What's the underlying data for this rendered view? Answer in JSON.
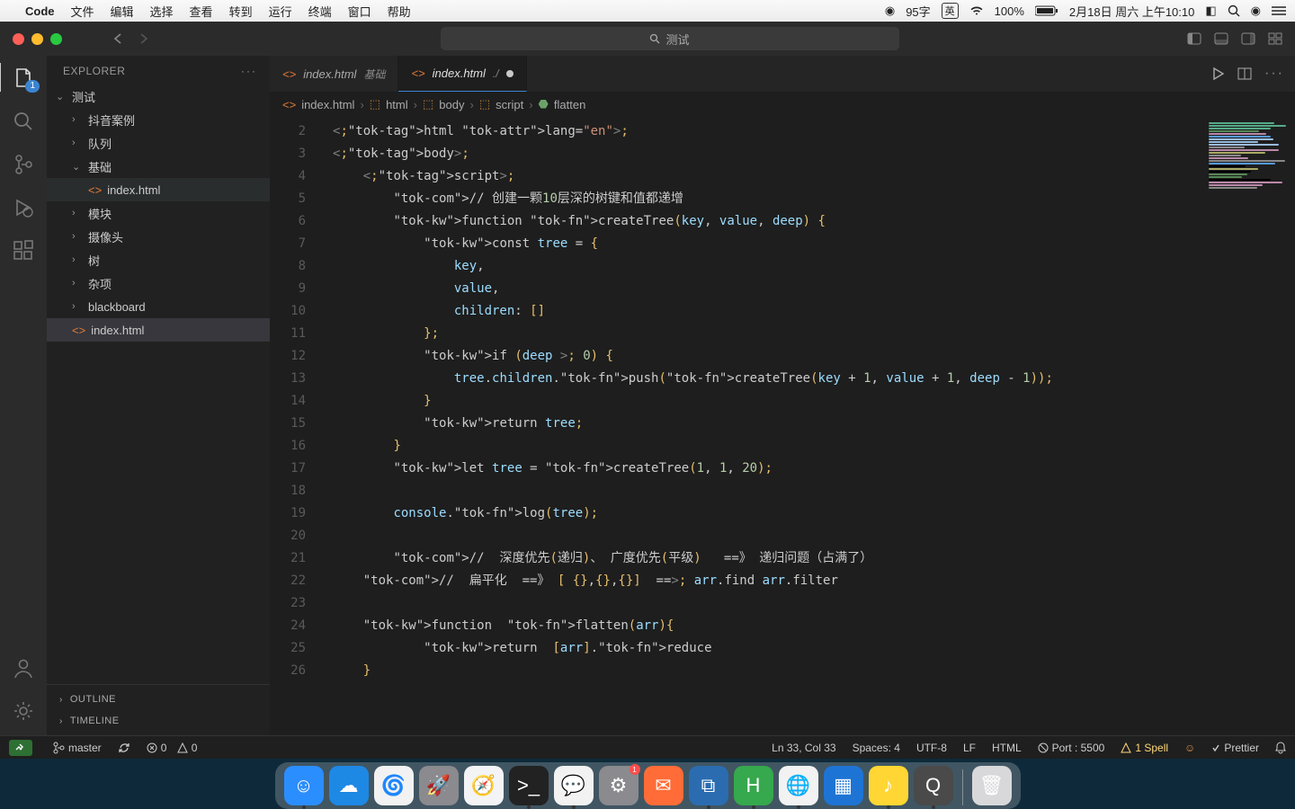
{
  "menubar": {
    "app": "Code",
    "items": [
      "文件",
      "编辑",
      "选择",
      "查看",
      "转到",
      "运行",
      "终端",
      "窗口",
      "帮助"
    ],
    "right": {
      "input": "95字",
      "lang": "英",
      "battery": "100%",
      "date": "2月18日 周六 上午10:10"
    }
  },
  "titlebar": {
    "search": "测试"
  },
  "activity_badge": "1",
  "explorer": {
    "title": "EXPLORER",
    "root": "测试",
    "items": [
      {
        "label": "抖音案例",
        "type": "folder"
      },
      {
        "label": "队列",
        "type": "folder"
      },
      {
        "label": "基础",
        "type": "folder",
        "open": true,
        "children": [
          {
            "label": "index.html",
            "type": "html",
            "sel": true
          }
        ]
      },
      {
        "label": "模块",
        "type": "folder"
      },
      {
        "label": "摄像头",
        "type": "folder"
      },
      {
        "label": "树",
        "type": "folder"
      },
      {
        "label": "杂项",
        "type": "folder"
      },
      {
        "label": "blackboard",
        "type": "folder"
      },
      {
        "label": "index.html",
        "type": "html",
        "active": true
      }
    ],
    "footer": [
      "OUTLINE",
      "TIMELINE"
    ]
  },
  "tabs": [
    {
      "file": "index.html",
      "desc": "基础",
      "active": false
    },
    {
      "file": "index.html",
      "desc": "./",
      "active": true,
      "modified": true
    }
  ],
  "breadcrumbs": [
    "index.html",
    "html",
    "body",
    "script",
    "flatten"
  ],
  "code": {
    "start": 2,
    "lines": [
      "<html lang=\"en\">",
      "<body>",
      "    <script>",
      "        // 创建一颗10层深的树键和值都递增",
      "        function createTree(key, value, deep) {",
      "            const tree = {",
      "                key,",
      "                value,",
      "                children: []",
      "            };",
      "            if (deep > 0) {",
      "                tree.children.push(createTree(key + 1, value + 1, deep - 1));",
      "            }",
      "            return tree;",
      "        }",
      "        let tree = createTree(1, 1, 20);",
      "",
      "        console.log(tree);",
      "",
      "        //  深度优先(递归)、 广度优先(平级)   ==》 递归问题（占满了）",
      "    //  扁平化  ==》 [ {},{},{}]  ==> arr.find arr.filter",
      "",
      "    function  flatten(arr){",
      "            return  [arr].reduce",
      "    }"
    ],
    "cursor_line": 33,
    "bulb_line": 33
  },
  "status": {
    "branch": "master",
    "sync": "",
    "errors": "0",
    "warnings": "0",
    "pos": "Ln 33, Col 33",
    "spaces": "Spaces: 4",
    "enc": "UTF-8",
    "eol": "LF",
    "lang": "HTML",
    "port": "Port : 5500",
    "spell": "1 Spell",
    "formatter": "Prettier"
  },
  "dock": [
    {
      "name": "finder",
      "bg": "#2b8eff",
      "emoji": "☺",
      "running": true
    },
    {
      "name": "baidu",
      "bg": "#1e88e5",
      "emoji": "☁"
    },
    {
      "name": "nie",
      "bg": "#f2f2f2",
      "emoji": "🌀"
    },
    {
      "name": "launchpad",
      "bg": "#8a8a8f",
      "emoji": "🚀"
    },
    {
      "name": "safari",
      "bg": "#f4f4f6",
      "emoji": "🧭"
    },
    {
      "name": "terminal",
      "bg": "#222",
      "emoji": ">_",
      "running": true
    },
    {
      "name": "wechat",
      "bg": "#f2f2f2",
      "emoji": "💬",
      "running": true
    },
    {
      "name": "settings",
      "bg": "#8a8a8f",
      "emoji": "⚙",
      "notif": "1"
    },
    {
      "name": "postman",
      "bg": "#ff6c37",
      "emoji": "✉"
    },
    {
      "name": "vscode",
      "bg": "#2b6cb0",
      "emoji": "⧉",
      "running": true
    },
    {
      "name": "hbuilder",
      "bg": "#36a84d",
      "emoji": "H",
      "running": true
    },
    {
      "name": "chrome",
      "bg": "#f2f2f2",
      "emoji": "🌐",
      "running": true
    },
    {
      "name": "app1",
      "bg": "#1e74d4",
      "emoji": "▦"
    },
    {
      "name": "music",
      "bg": "#ffd633",
      "emoji": "♪",
      "running": true
    },
    {
      "name": "quicktime",
      "bg": "#4a4a4a",
      "emoji": "Q",
      "running": true
    },
    {
      "name": "trash",
      "bg": "#d8d8da",
      "emoji": "🗑"
    }
  ]
}
